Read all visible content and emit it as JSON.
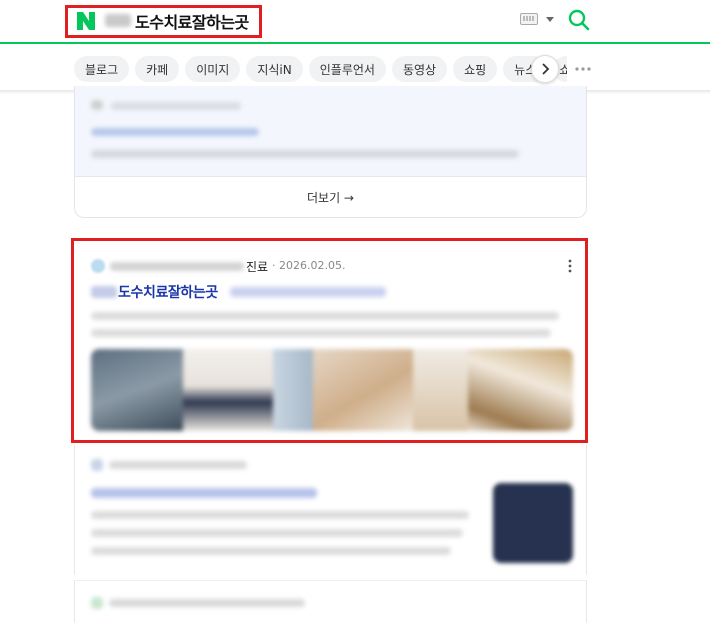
{
  "header": {
    "query": "도수치료잘하는곳",
    "logo_icon": "naver-n-icon",
    "brand_color": "#03c75a",
    "highlight_color": "#e02020",
    "keyboard_icon": "keyboard-icon",
    "search_icon": "search-icon"
  },
  "tabs": {
    "items": [
      {
        "label": "블로그"
      },
      {
        "label": "카페"
      },
      {
        "label": "이미지"
      },
      {
        "label": "지식iN"
      },
      {
        "label": "인플루언서"
      },
      {
        "label": "동영상"
      },
      {
        "label": "쇼핑"
      },
      {
        "label": "뉴스"
      },
      {
        "label": "쇼"
      }
    ],
    "next_icon": "chevron-right-icon",
    "more_icon": "more-dots-icon"
  },
  "card1": {
    "more_label": "더보기 →"
  },
  "result": {
    "source_suffix": "진료",
    "date": "· 2026.02.05.",
    "title": "도수치료잘하는곳",
    "title_color": "#1a36a8"
  }
}
